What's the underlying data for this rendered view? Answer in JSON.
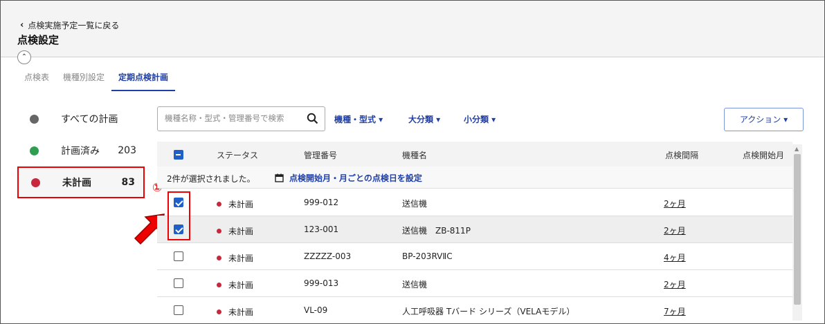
{
  "header": {
    "back_label": "点検実施予定一覧に戻る",
    "title": "点検設定"
  },
  "tabs": [
    {
      "label": "点検表",
      "active": false
    },
    {
      "label": "機種別設定",
      "active": false
    },
    {
      "label": "定期点検計画",
      "active": true
    }
  ],
  "sidebar": {
    "items": [
      {
        "label": "すべての計画",
        "count": "",
        "color": "#666666"
      },
      {
        "label": "計画済み",
        "count": "203",
        "color": "#2e9e4f"
      },
      {
        "label": "未計画",
        "count": "83",
        "color": "#c8273c"
      }
    ]
  },
  "annotation": {
    "number": "①"
  },
  "toolbar": {
    "search_placeholder": "機種名称・型式・管理番号で検索",
    "filters": [
      "機種・型式 ▾",
      "大分類 ▾",
      "小分類 ▾"
    ],
    "action_label": "アクション ▾"
  },
  "table": {
    "columns": [
      "ステータス",
      "管理番号",
      "機種名",
      "点検間隔",
      "点検開始月"
    ],
    "selection_info": "2件が選択されました。",
    "selection_action": "点検開始月・月ごとの点検日を設定",
    "rows": [
      {
        "status": "未計画",
        "id": "999-012",
        "model": "送信機",
        "interval": "2ヶ月",
        "checked": true
      },
      {
        "status": "未計画",
        "id": "123-001",
        "model": "送信機　ZB-811P",
        "interval": "2ヶ月",
        "checked": true
      },
      {
        "status": "未計画",
        "id": "ZZZZZ-003",
        "model": "BP-203RVⅡC",
        "interval": "4ヶ月",
        "checked": false
      },
      {
        "status": "未計画",
        "id": "999-013",
        "model": "送信機",
        "interval": "2ヶ月",
        "checked": false
      },
      {
        "status": "未計画",
        "id": "VL-09",
        "model": "人工呼吸器 Tバード シリーズ（VELAモデル）",
        "interval": "7ヶ月",
        "checked": false
      }
    ]
  },
  "colors": {
    "accent": "#1f3fa8",
    "highlight": "#e00000",
    "status_unplanned": "#c8273c"
  }
}
